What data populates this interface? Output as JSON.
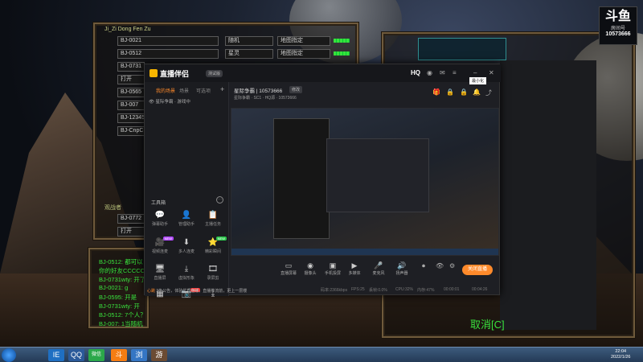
{
  "game": {
    "player_title": "Ji_Zi Dong Fen Zu",
    "slots": [
      {
        "name": "BJ-0021",
        "race": "随机",
        "team": "地图指定"
      },
      {
        "name": "BJ-0512",
        "race": "星灵",
        "team": "地图指定"
      },
      {
        "name": "BJ-0731",
        "race": "",
        "team": ""
      },
      {
        "name": "打开",
        "race": "",
        "team": ""
      },
      {
        "name": "BJ-0565",
        "race": "",
        "team": ""
      },
      {
        "name": "BJ-007",
        "race": "",
        "team": ""
      },
      {
        "name": "BJ-12345",
        "race": "",
        "team": ""
      },
      {
        "name": "BJ-CnpC",
        "race": "",
        "team": ""
      }
    ],
    "observers_label": "观战者",
    "observers": [
      "BJ-0772",
      "打开"
    ],
    "chat": [
      "BJ-0512: 都可以",
      "你的好友CCCCC",
      "BJ-0731wty: 开了",
      "BJ-0021: g",
      "BJ-0595: 开是",
      "BJ-0731wty: 开",
      "BJ-0512: 7个人？",
      "BJ-007: 1当随机"
    ],
    "broadcast_text": "取消[C]"
  },
  "room_card": {
    "logo": "斗鱼",
    "label": "房间号",
    "number": "10573666"
  },
  "app": {
    "brand": "直播伴侣",
    "version_badge": "测试版",
    "hq": "HQ",
    "tooltip": "最小化",
    "tabs": [
      "我的场景",
      "场景",
      "可选项"
    ],
    "scene_row": "星际争霸 · 游戏中",
    "room_title": "星际争霸 | 10573666",
    "room_badge": "修改",
    "room_sub": "星际争霸 · SC1 · HQ源 · 10573666",
    "toolbox_title": "工具箱",
    "tools": [
      {
        "label": "弹幕助手",
        "icon": "💬",
        "badge": ""
      },
      {
        "label": "管理助手",
        "icon": "👤",
        "badge": ""
      },
      {
        "label": "主播任务",
        "icon": "📋",
        "badge": ""
      },
      {
        "label": "视频连麦",
        "icon": "🎥",
        "badge": "NEW"
      },
      {
        "label": "多人连麦",
        "icon": "⬇",
        "badge": ""
      },
      {
        "label": "精彩瞬间",
        "icon": "⭐",
        "badge": "NEW"
      },
      {
        "label": "直播屏",
        "icon": "🖥",
        "badge": ""
      },
      {
        "label": "虚拟形象",
        "icon": "⤓",
        "badge": ""
      },
      {
        "label": "录屏剪",
        "icon": "🎞",
        "badge": ""
      },
      {
        "label": "",
        "icon": "▦",
        "badge": ""
      },
      {
        "label": "",
        "icon": "📷",
        "badge": "HOT"
      },
      {
        "label": "",
        "icon": "⤓",
        "badge": ""
      }
    ],
    "notice_prefix": "心跳",
    "notice_text": "3条公告，体验优质直播，直播推流前，更上一层楼",
    "actions": [
      {
        "label": "直播屏幕",
        "icon": "▭"
      },
      {
        "label": "摄像头",
        "icon": "◉"
      },
      {
        "label": "手机投屏",
        "icon": "▣"
      },
      {
        "label": "多媒体",
        "icon": "▶"
      },
      {
        "label": "麦克风",
        "icon": "🎤"
      },
      {
        "label": "扬声器",
        "icon": "🔊"
      }
    ],
    "live_button": "关闭直播",
    "status": {
      "bitrate": "码率:2366kbps",
      "fps": "FPS:25",
      "drop": "丢帧:0.0%",
      "cpu": "CPU:32%",
      "mem": "内存:47%",
      "time1": "00:00:01",
      "time2": "00:04:26"
    }
  },
  "taskbar": {
    "apps": [
      "IE",
      "QQ",
      "微信",
      "斗",
      "浏",
      "游"
    ],
    "time": "22:04",
    "date": "2022/1/26"
  }
}
